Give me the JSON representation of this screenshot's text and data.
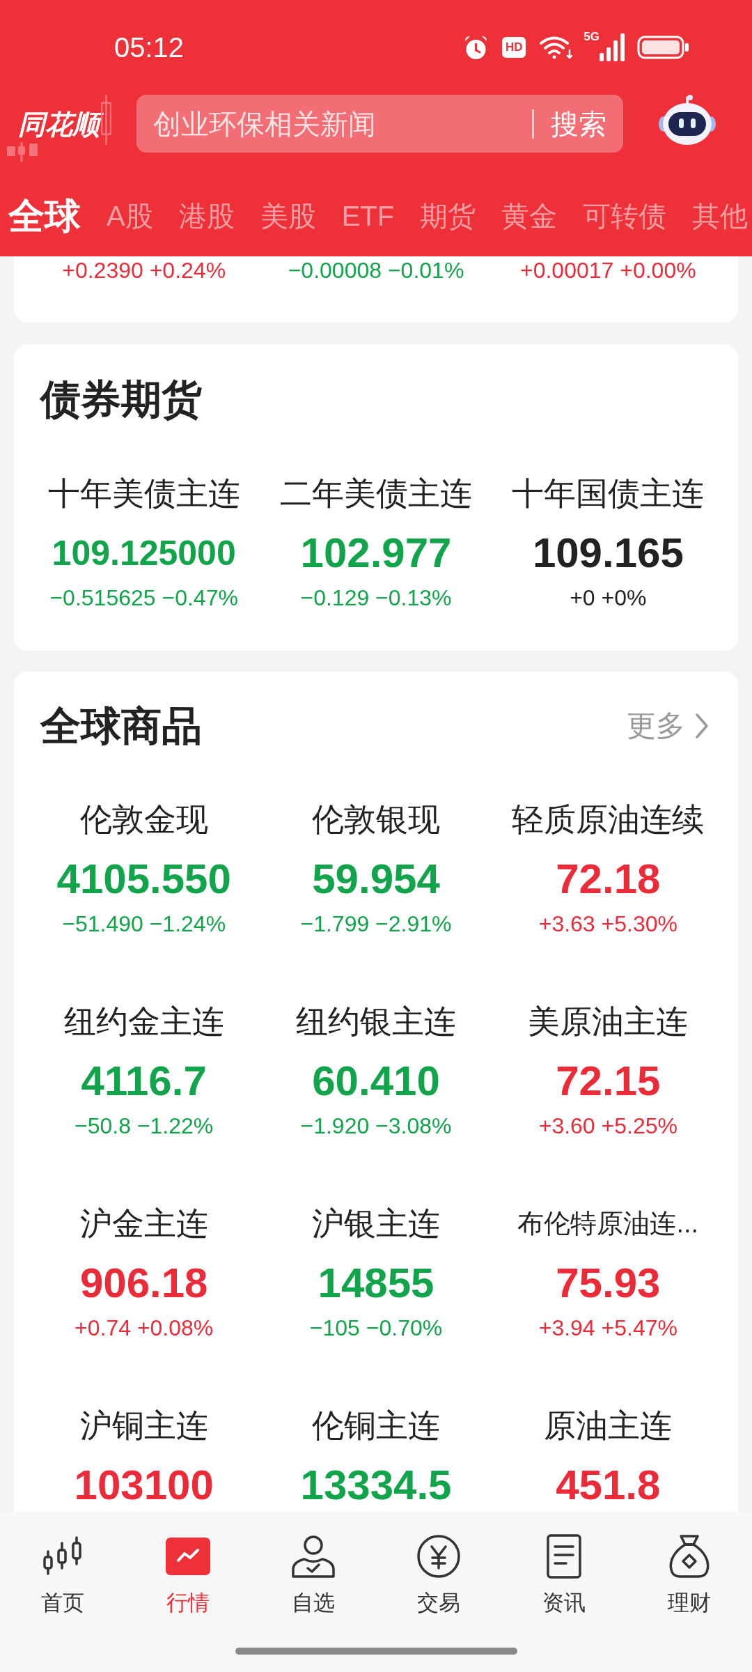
{
  "status_bar": {
    "time": "05:12",
    "hd_badge": "HD",
    "network": "5G"
  },
  "header": {
    "logo": "同花顺",
    "search": {
      "placeholder": "创业环保相关新闻",
      "button": "搜索"
    }
  },
  "market_tabs": [
    {
      "label": "全球",
      "selected": true
    },
    {
      "label": "A股",
      "selected": false
    },
    {
      "label": "港股",
      "selected": false
    },
    {
      "label": "美股",
      "selected": false
    },
    {
      "label": "ETF",
      "selected": false
    },
    {
      "label": "期货",
      "selected": false
    },
    {
      "label": "黄金",
      "selected": false
    },
    {
      "label": "可转债",
      "selected": false
    },
    {
      "label": "其他",
      "selected": false
    }
  ],
  "previous_card": {
    "items": [
      {
        "change": "+0.2390 +0.24%",
        "color": "#ec2b39"
      },
      {
        "change": "−0.00008 −0.01%",
        "color": "#11a44b"
      },
      {
        "change": "+0.00017 +0.00%",
        "color": "#ec2b39"
      }
    ]
  },
  "bond_futures": {
    "title": "债券期货",
    "items": [
      {
        "name": "十年美债主连",
        "value": "109.125000",
        "change": "−0.515625 −0.47%",
        "color": "#11a44b"
      },
      {
        "name": "二年美债主连",
        "value": "102.977",
        "change": "−0.129 −0.13%",
        "color": "#11a44b"
      },
      {
        "name": "十年国债主连",
        "value": "109.165",
        "change": "+0 +0%",
        "color": "#222222"
      }
    ]
  },
  "global_commodities": {
    "title": "全球商品",
    "more": "更多",
    "items": [
      {
        "name": "伦敦金现",
        "value": "4105.550",
        "change": "−51.490 −1.24%",
        "color": "#11a44b"
      },
      {
        "name": "伦敦银现",
        "value": "59.954",
        "change": "−1.799 −2.91%",
        "color": "#11a44b"
      },
      {
        "name": "轻质原油连续",
        "value": "72.18",
        "change": "+3.63 +5.30%",
        "color": "#ec2b39"
      },
      {
        "name": "纽约金主连",
        "value": "4116.7",
        "change": "−50.8 −1.22%",
        "color": "#11a44b"
      },
      {
        "name": "纽约银主连",
        "value": "60.410",
        "change": "−1.920 −3.08%",
        "color": "#11a44b"
      },
      {
        "name": "美原油主连",
        "value": "72.15",
        "change": "+3.60 +5.25%",
        "color": "#ec2b39"
      },
      {
        "name": "沪金主连",
        "value": "906.18",
        "change": "+0.74 +0.08%",
        "color": "#ec2b39"
      },
      {
        "name": "沪银主连",
        "value": "14855",
        "change": "−105 −0.70%",
        "color": "#11a44b"
      },
      {
        "name": "布伦特原油连...",
        "value": "75.93",
        "change": "+3.94 +5.47%",
        "color": "#ec2b39"
      },
      {
        "name": "沪铜主连",
        "value": "103100",
        "color": "#ec2b39"
      },
      {
        "name": "伦铜主连",
        "value": "13334.5",
        "color": "#11a44b"
      },
      {
        "name": "原油主连",
        "value": "451.8",
        "color": "#ec2b39"
      }
    ]
  },
  "bottom_nav": [
    {
      "label": "首页",
      "selected": false
    },
    {
      "label": "行情",
      "selected": true
    },
    {
      "label": "自选",
      "selected": false
    },
    {
      "label": "交易",
      "selected": false
    },
    {
      "label": "资讯",
      "selected": false
    },
    {
      "label": "理财",
      "selected": false
    }
  ]
}
